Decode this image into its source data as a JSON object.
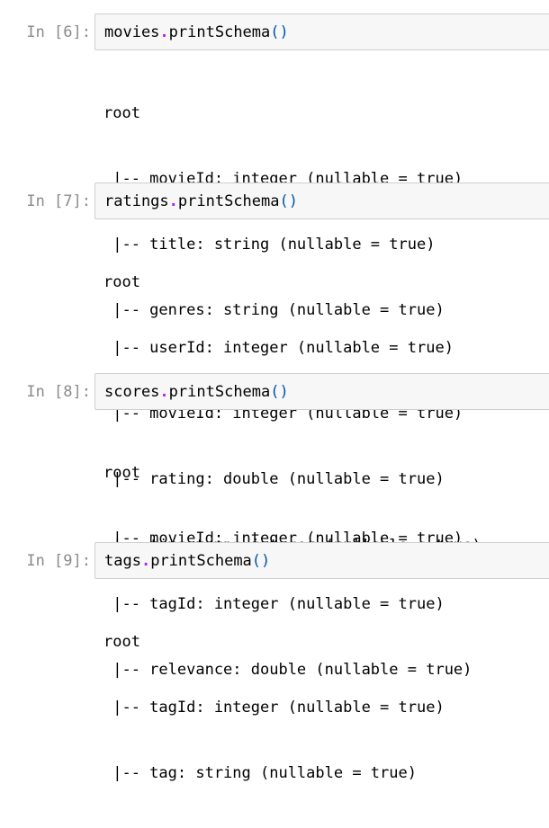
{
  "cells": [
    {
      "prompt": "In [6]:",
      "code": {
        "var": "movies",
        "dot": ".",
        "method": "printSchema",
        "open": "(",
        "close": ")"
      },
      "output": [
        "root",
        " |-- movieId: integer (nullable = true)",
        " |-- title: string (nullable = true)",
        " |-- genres: string (nullable = true)"
      ]
    },
    {
      "prompt": "In [7]:",
      "code": {
        "var": "ratings",
        "dot": ".",
        "method": "printSchema",
        "open": "(",
        "close": ")"
      },
      "output": [
        "root",
        " |-- userId: integer (nullable = true)",
        " |-- movieId: integer (nullable = true)",
        " |-- rating: double (nullable = true)",
        " |-- timestamp: integer (nullable = true)"
      ]
    },
    {
      "prompt": "In [8]:",
      "code": {
        "var": "scores",
        "dot": ".",
        "method": "printSchema",
        "open": "(",
        "close": ")"
      },
      "output": [
        "root",
        " |-- movieId: integer (nullable = true)",
        " |-- tagId: integer (nullable = true)",
        " |-- relevance: double (nullable = true)"
      ]
    },
    {
      "prompt": "In [9]:",
      "code": {
        "var": "tags",
        "dot": ".",
        "method": "printSchema",
        "open": "(",
        "close": ")"
      },
      "output": [
        "root",
        " |-- tagId: integer (nullable = true)",
        " |-- tag: string (nullable = true)"
      ]
    }
  ]
}
